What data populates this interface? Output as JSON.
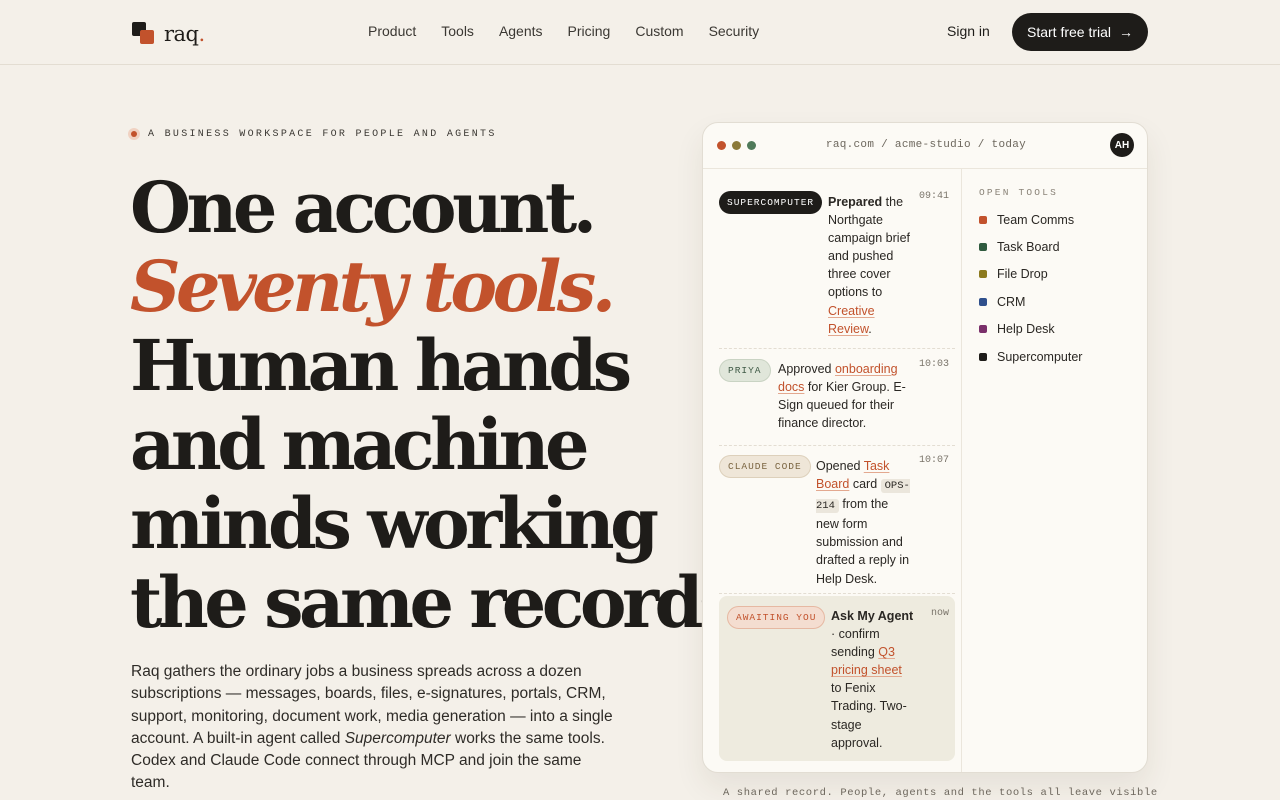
{
  "brand": {
    "name": "raq",
    "dot": ".",
    "accent": "#c2522c"
  },
  "nav": [
    "Product",
    "Tools",
    "Agents",
    "Pricing",
    "Custom",
    "Security"
  ],
  "header": {
    "signin": "Sign in",
    "cta": "Start free trial",
    "cta_icon": "→"
  },
  "hero": {
    "eyebrow": "A BUSINESS WORKSPACE FOR PEOPLE AND AGENTS",
    "lines": [
      "One account.",
      "Seventy tools.",
      "Human hands",
      "and machine",
      "minds working",
      "the same records."
    ],
    "lede_before": "Raq gathers the ordinary jobs a business spreads across a dozen subscriptions — messages, boards, files, e-signatures, portals, CRM, support, monitoring, document work, media generation — into a single account. A built-in agent called ",
    "lede_em": "Supercomputer",
    "lede_after": " works the same tools. Codex and Claude Code connect through MCP and join the same team."
  },
  "panel": {
    "address": "raq.com / acme-studio / today",
    "avatar": "AH",
    "window_dots": [
      "#c2522c",
      "#8c7a3a",
      "#4f7a5a"
    ],
    "feed": [
      {
        "tag": "SUPERCOMPUTER",
        "time": "09:41",
        "bold": "Prepared",
        "t1": " the Northgate campaign brief and pushed three cover options to ",
        "link": "Creative Review",
        "t2": "."
      },
      {
        "tag": "PRIYA",
        "time": "10:03",
        "t1": "Approved ",
        "link": "onboarding docs",
        "t2": " for Kier Group. E-Sign queued for their finance director."
      },
      {
        "tag": "CLAUDE CODE",
        "time": "10:07",
        "t1": "Opened ",
        "link": "Task Board",
        "t2": " card ",
        "code": "OPS-214",
        "t3": " from the new form submission and drafted a reply in Help Desk."
      },
      {
        "tag": "AWAITING YOU",
        "time": "now",
        "bold": "Ask My Agent",
        "t1": " · confirm sending ",
        "link": "Q3 pricing sheet",
        "t2": " to Fenix Trading. Two-stage approval."
      }
    ],
    "tools_title": "OPEN TOOLS",
    "tools": [
      {
        "name": "Team Comms",
        "color": "#c2522c"
      },
      {
        "name": "Task Board",
        "color": "#2f5a3e"
      },
      {
        "name": "File Drop",
        "color": "#8c7a1e"
      },
      {
        "name": "CRM",
        "color": "#2f4f8c"
      },
      {
        "name": "Help Desk",
        "color": "#7a2f6a"
      },
      {
        "name": "Supercomputer",
        "color": "#1e1c19"
      }
    ]
  },
  "caption": "A shared record. People, agents and the tools all leave visible"
}
